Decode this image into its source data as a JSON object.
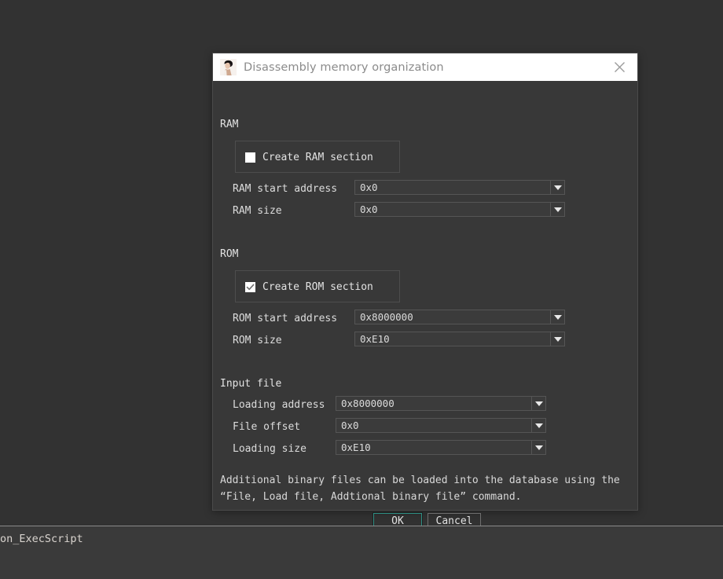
{
  "window": {
    "title": "Disassembly memory organization",
    "icon": "ida-avatar-icon",
    "close_icon": "close-icon"
  },
  "ram": {
    "section_label": "RAM",
    "checkbox": {
      "label": "Create RAM section",
      "checked": false
    },
    "fields": [
      {
        "label": "RAM start address",
        "value": "0x0"
      },
      {
        "label": "RAM size",
        "value": "0x0"
      }
    ]
  },
  "rom": {
    "section_label": "ROM",
    "checkbox": {
      "label": "Create ROM section",
      "checked": true
    },
    "fields": [
      {
        "label": "ROM start address",
        "value": "0x8000000"
      },
      {
        "label": "ROM size",
        "value": "0xE10"
      }
    ]
  },
  "input_file": {
    "section_label": "Input file",
    "fields": [
      {
        "label": "Loading address",
        "value": "0x8000000"
      },
      {
        "label": "File offset",
        "value": "0x0"
      },
      {
        "label": "Loading size",
        "value": "0xE10"
      }
    ]
  },
  "note": {
    "line1": "Additional binary files can be loaded into the database using the",
    "line2": "“File, Load file, Addtional binary file” command."
  },
  "buttons": {
    "ok": "OK",
    "cancel": "Cancel"
  },
  "background": {
    "status_text": "on_ExecScript"
  },
  "colors": {
    "window_bg": "#383838",
    "desktop_bg": "#323232",
    "titlebar_bg": "#ffffff",
    "title_text": "#8b8b8b",
    "accent_ok_border": "#2f8f84",
    "combo_border": "#555555",
    "text": "#e3e3e3"
  }
}
